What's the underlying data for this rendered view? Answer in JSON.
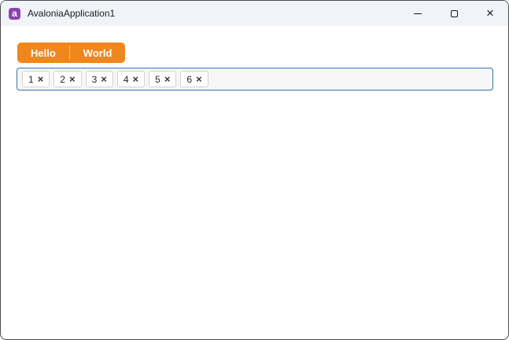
{
  "window": {
    "title": "AvaloniaApplication1",
    "app_icon_letter": "a",
    "controls": {
      "close_glyph": "×"
    }
  },
  "colors": {
    "accent_orange": "#f0871c",
    "input_border_blue": "#3177b0",
    "logo_purple": "#8b44ac",
    "titlebar_bg": "#f0f3f8"
  },
  "split_button": {
    "items": [
      {
        "label": "Hello"
      },
      {
        "label": "World"
      }
    ]
  },
  "tag_input": {
    "remove_glyph": "×",
    "tags": [
      {
        "label": "1"
      },
      {
        "label": "2"
      },
      {
        "label": "3"
      },
      {
        "label": "4"
      },
      {
        "label": "5"
      },
      {
        "label": "6"
      }
    ]
  }
}
